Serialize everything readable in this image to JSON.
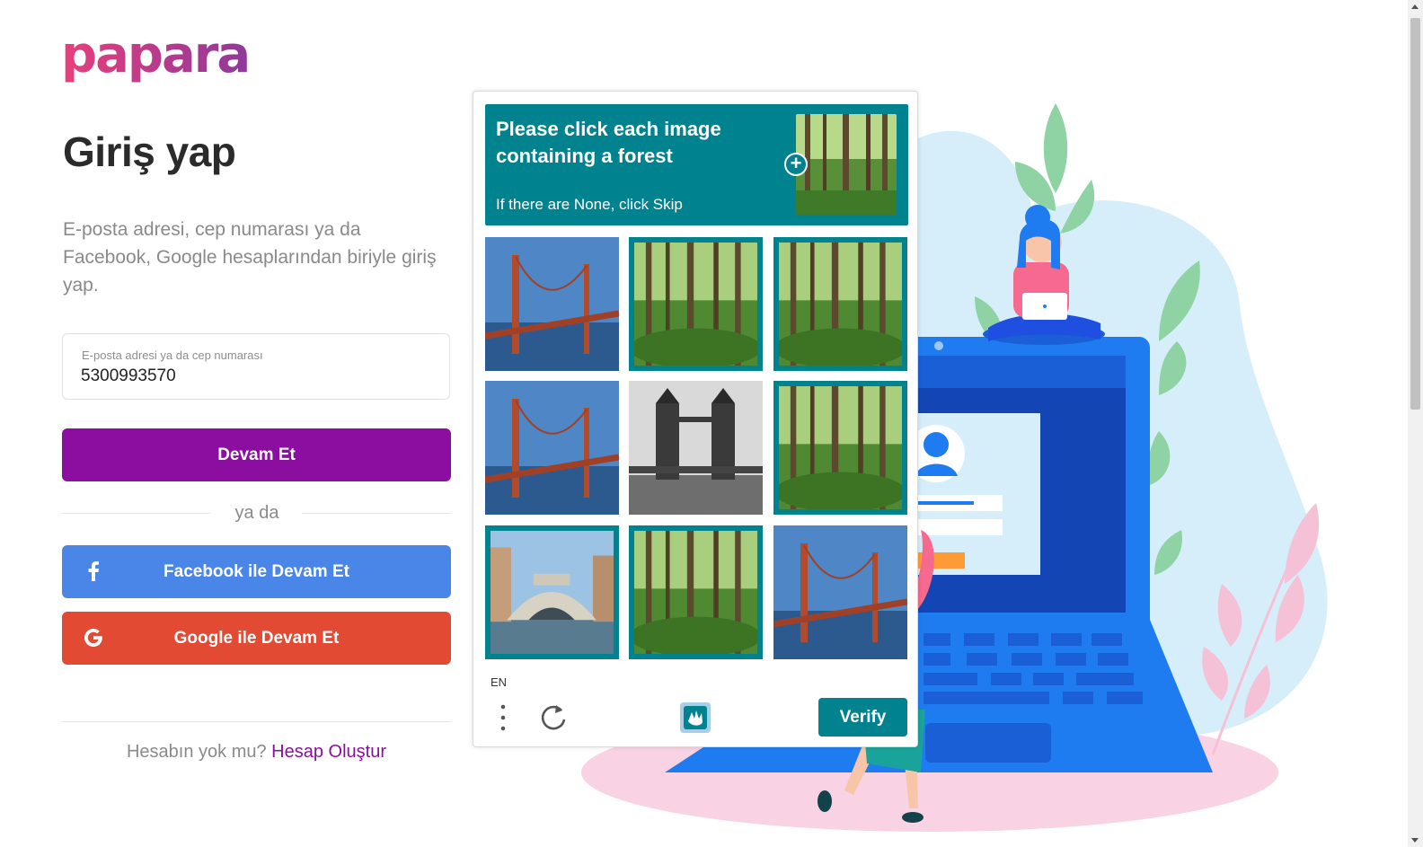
{
  "brand": {
    "logo_text": "papara"
  },
  "login": {
    "title": "Giriş yap",
    "subtitle": "E-posta adresi, cep numarası ya da Facebook, Google hesaplarından biriyle giriş yap.",
    "field_label": "E-posta adresi ya da cep numarası",
    "field_value": "5300993570",
    "continue_label": "Devam Et",
    "or_label": "ya da",
    "facebook_label": "Facebook ile Devam Et",
    "facebook_icon": "facebook-icon",
    "google_label": "Google ile Devam Et",
    "google_icon": "google-icon",
    "signup_prompt": "Hesabın yok mu?",
    "signup_link": "Hesap Oluştur"
  },
  "captcha": {
    "prompt": "Please click each image containing a forest",
    "hint": "If there are None, click Skip",
    "language": "EN",
    "verify_label": "Verify",
    "tiles": [
      {
        "content": "bridge",
        "selected": false
      },
      {
        "content": "forest",
        "selected": true
      },
      {
        "content": "forest",
        "selected": true
      },
      {
        "content": "bridge",
        "selected": false
      },
      {
        "content": "tower-bridge",
        "selected": false
      },
      {
        "content": "forest",
        "selected": true
      },
      {
        "content": "rialto-bridge",
        "selected": true
      },
      {
        "content": "forest",
        "selected": true
      },
      {
        "content": "bridge",
        "selected": false
      }
    ]
  },
  "colors": {
    "brand_purple": "#8b0ea0",
    "facebook_blue": "#4a86e8",
    "google_red": "#e34a33",
    "captcha_teal": "#00838f"
  }
}
